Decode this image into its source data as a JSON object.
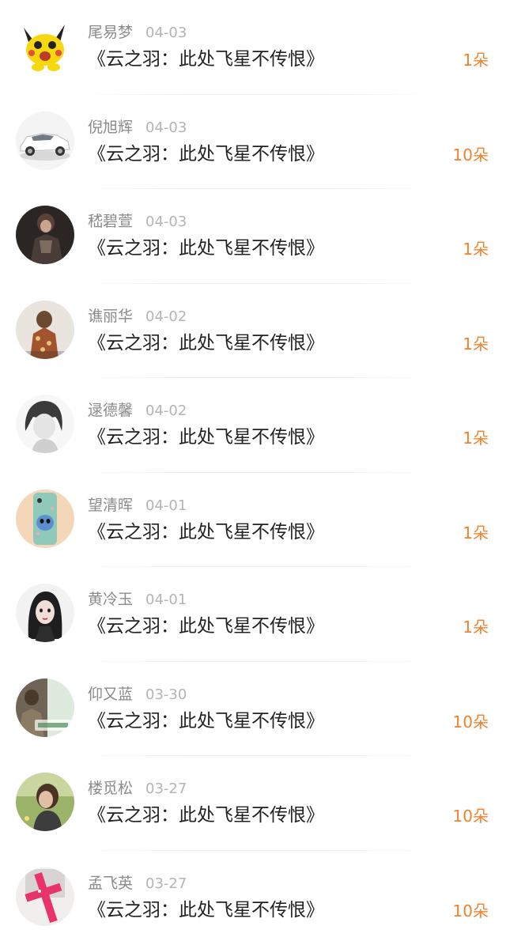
{
  "list": {
    "items": [
      {
        "name": "尾易梦",
        "date": "04-03",
        "title": "《云之羽：此处飞星不传恨》",
        "count": "1朵",
        "avatar": "pikachu-avatar"
      },
      {
        "name": "倪旭辉",
        "date": "04-03",
        "title": "《云之羽：此处飞星不传恨》",
        "count": "10朵",
        "avatar": "white-car-avatar"
      },
      {
        "name": "嵇碧萱",
        "date": "04-03",
        "title": "《云之羽：此处飞星不传恨》",
        "count": "1朵",
        "avatar": "dark-woman-avatar"
      },
      {
        "name": "谯丽华",
        "date": "04-02",
        "title": "《云之羽：此处飞星不传恨》",
        "count": "1朵",
        "avatar": "girl-back-avatar"
      },
      {
        "name": "逯德馨",
        "date": "04-02",
        "title": "《云之羽：此处飞星不传恨》",
        "count": "1朵",
        "avatar": "grayscale-girl-avatar"
      },
      {
        "name": "望清晖",
        "date": "04-01",
        "title": "《云之羽：此处飞星不传恨》",
        "count": "1朵",
        "avatar": "stitch-phone-avatar"
      },
      {
        "name": "黄冷玉",
        "date": "04-01",
        "title": "《云之羽：此处飞星不传恨》",
        "count": "1朵",
        "avatar": "anime-girl-avatar"
      },
      {
        "name": "仰又蓝",
        "date": "03-30",
        "title": "《云之羽：此处飞星不传恨》",
        "count": "10朵",
        "avatar": "green-photo-avatar"
      },
      {
        "name": "楼觅松",
        "date": "03-27",
        "title": "《云之羽：此处飞星不传恨》",
        "count": "10朵",
        "avatar": "grass-girl-avatar"
      },
      {
        "name": "孟飞英",
        "date": "03-27",
        "title": "《云之羽：此处飞星不传恨》",
        "count": "10朵",
        "avatar": "pink-cross-avatar"
      }
    ]
  },
  "colors": {
    "count": "#f0822d",
    "name": "#8a8a8a",
    "date": "#b4b4b4",
    "title": "#222222"
  }
}
